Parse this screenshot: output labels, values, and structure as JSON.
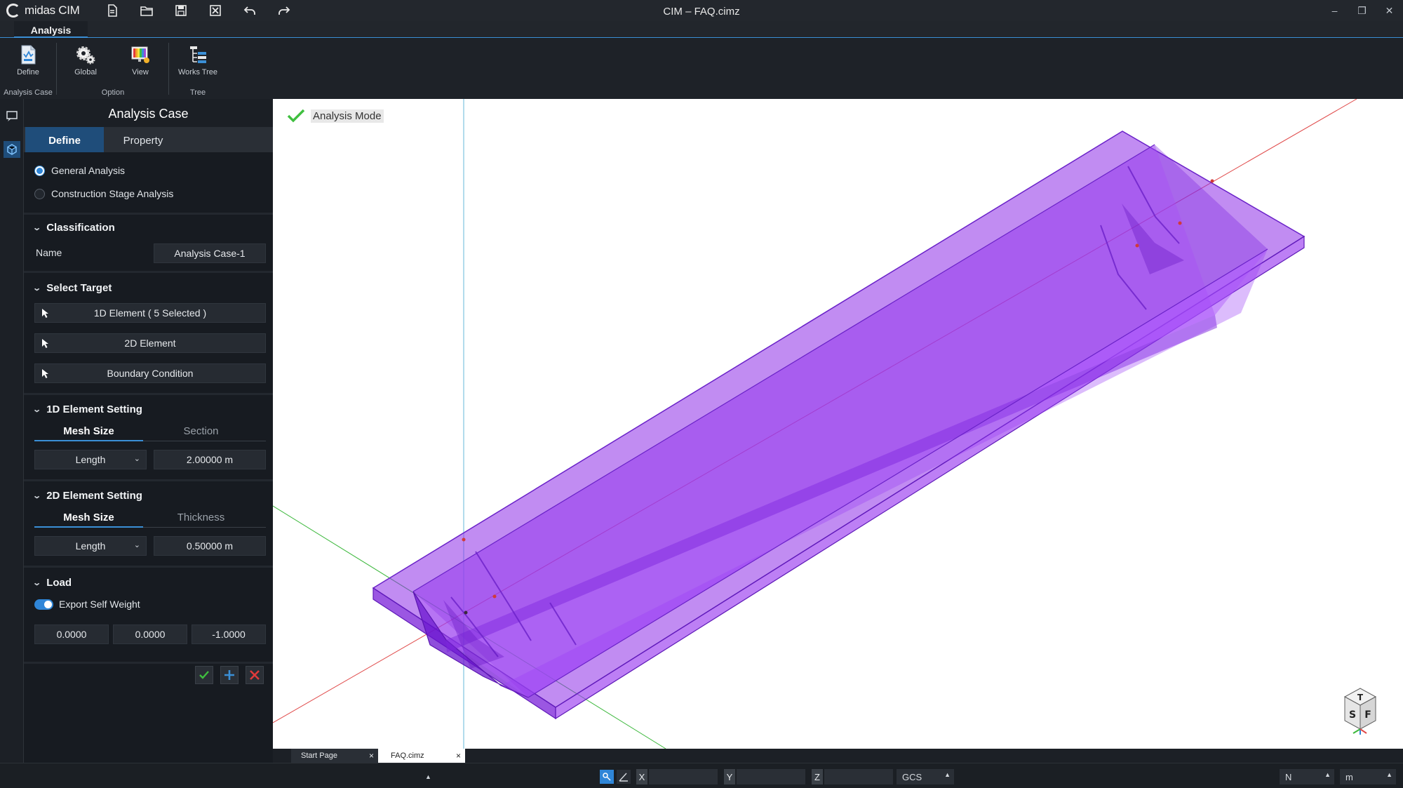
{
  "app": {
    "logo_text": "midas CIM",
    "window_title": "CIM – FAQ.cimz",
    "quick_access": [
      {
        "icon": "new-file-icon"
      },
      {
        "icon": "open-folder-icon"
      },
      {
        "icon": "save-icon"
      },
      {
        "icon": "close-file-icon"
      },
      {
        "icon": "undo-icon"
      },
      {
        "icon": "redo-icon"
      }
    ],
    "window_controls": {
      "minimize": "–",
      "restore": "❐",
      "close": "✕"
    }
  },
  "ribbon": {
    "active_tab": "Analysis",
    "groups": [
      {
        "label": "Analysis Case",
        "buttons": [
          {
            "label": "Define",
            "icon": "define-icon"
          }
        ]
      },
      {
        "label": "Option",
        "buttons": [
          {
            "label": "Global",
            "icon": "gear-icon"
          },
          {
            "label": "View",
            "icon": "view-settings-icon"
          }
        ]
      },
      {
        "label": "Tree",
        "buttons": [
          {
            "label": "Works Tree",
            "icon": "works-tree-icon"
          }
        ]
      }
    ]
  },
  "panel": {
    "title": "Analysis Case",
    "tabs": [
      "Define",
      "Property"
    ],
    "active_tab": "Define",
    "analysis_types": [
      "General Analysis",
      "Construction Stage Analysis"
    ],
    "selected_analysis_type": "General Analysis",
    "classification": {
      "header": "Classification",
      "name_label": "Name",
      "name_value": "Analysis Case-1"
    },
    "select_target": {
      "header": "Select Target",
      "buttons": [
        "1D Element ( 5 Selected )",
        "2D Element",
        "Boundary Condition"
      ]
    },
    "element_1d": {
      "header": "1D Element Setting",
      "tabs": [
        "Mesh Size",
        "Section"
      ],
      "active_tab": "Mesh Size",
      "method": "Length",
      "value": "2.00000 m"
    },
    "element_2d": {
      "header": "2D Element Setting",
      "tabs": [
        "Mesh Size",
        "Thickness"
      ],
      "active_tab": "Mesh Size",
      "method": "Length",
      "value": "0.50000 m"
    },
    "load": {
      "header": "Load",
      "toggle_label": "Export Self Weight",
      "toggle_on": true,
      "vector": [
        "0.0000",
        "0.0000",
        "-1.0000"
      ]
    },
    "actions": [
      {
        "icon": "check-icon",
        "color": "#3fbf3f"
      },
      {
        "icon": "plus-icon",
        "color": "#3a8fd6"
      },
      {
        "icon": "close-icon",
        "color": "#e03a3a"
      }
    ]
  },
  "viewport": {
    "mode_label": "Analysis Mode",
    "model_color": "#a040f0",
    "view_cube_faces": [
      "T",
      "S",
      "F"
    ]
  },
  "doc_tabs": [
    {
      "label": "Start Page",
      "active": false
    },
    {
      "label": "FAQ.cimz",
      "active": true
    }
  ],
  "status": {
    "coord_labels": [
      "X",
      "Y",
      "Z"
    ],
    "coord_system": "GCS",
    "force_unit": "N",
    "length_unit": "m"
  }
}
